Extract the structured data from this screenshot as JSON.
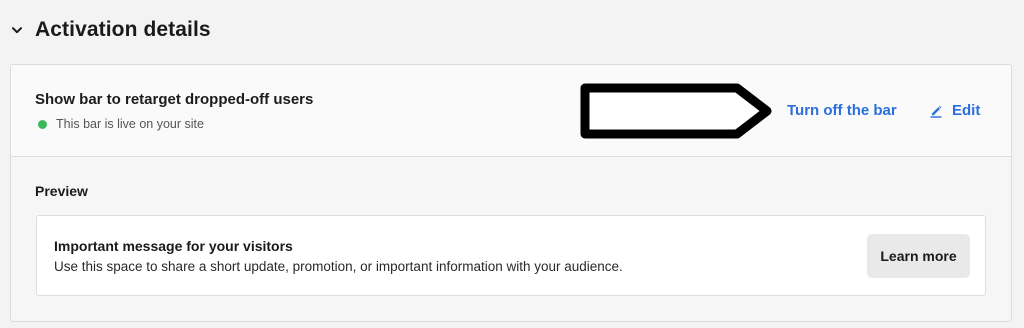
{
  "section": {
    "title": "Activation details",
    "chevron_icon": "chevron-down-icon"
  },
  "bar": {
    "title": "Show bar to retarget dropped-off users",
    "status_text": "This bar is live on your site",
    "status_color": "#3cb85c",
    "turn_off_label": "Turn off the bar",
    "edit_label": "Edit",
    "edit_icon": "pencil-icon",
    "link_color": "#2a6fdb"
  },
  "preview": {
    "label": "Preview",
    "message_title": "Important message for your visitors",
    "message_body": "Use this space to share a short update, promotion, or important information with your audience.",
    "button_label": "Learn more"
  }
}
